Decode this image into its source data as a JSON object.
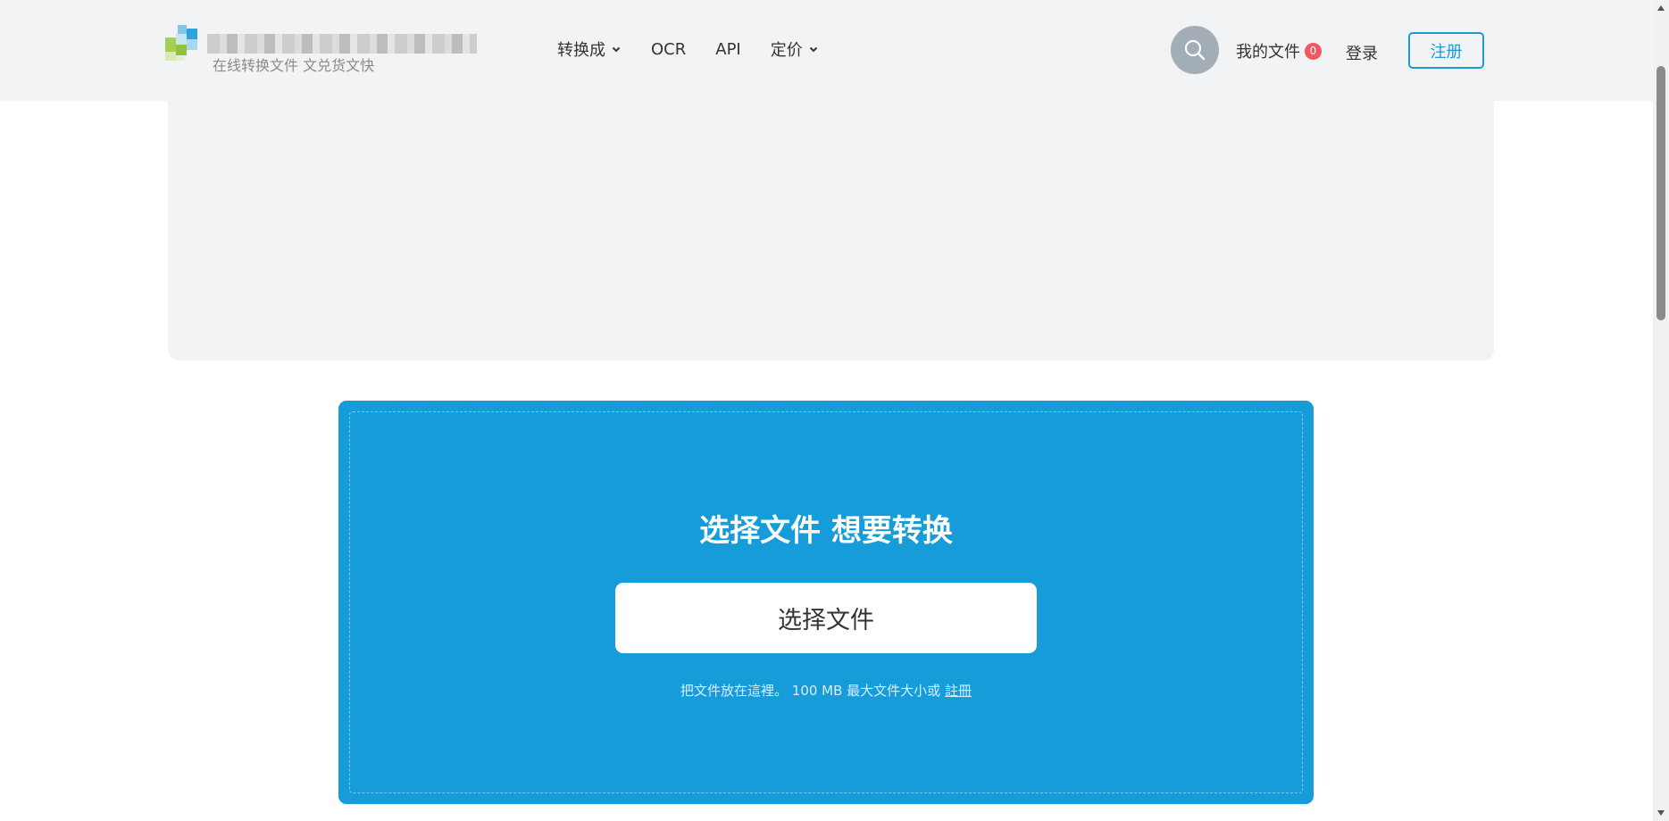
{
  "header": {
    "logo_tagline": "在线转换文件 文兑货文快",
    "nav": [
      {
        "label": "转换成",
        "dropdown": true
      },
      {
        "label": "OCR",
        "dropdown": false
      },
      {
        "label": "API",
        "dropdown": false
      },
      {
        "label": "定价",
        "dropdown": true
      }
    ],
    "my_files_label": "我的文件",
    "my_files_count": "0",
    "login_label": "登录",
    "register_label": "注册"
  },
  "upload": {
    "title": "选择文件 想要转换",
    "button_label": "选择文件",
    "note_text": "把文件放在這裡。 100 MB 最大文件大小或",
    "note_link": "註冊"
  },
  "colors": {
    "accent": "#1a9bd7",
    "upload_bg": "#159cd9",
    "badge": "#f1585f",
    "header_bg": "#f2f3f4"
  }
}
